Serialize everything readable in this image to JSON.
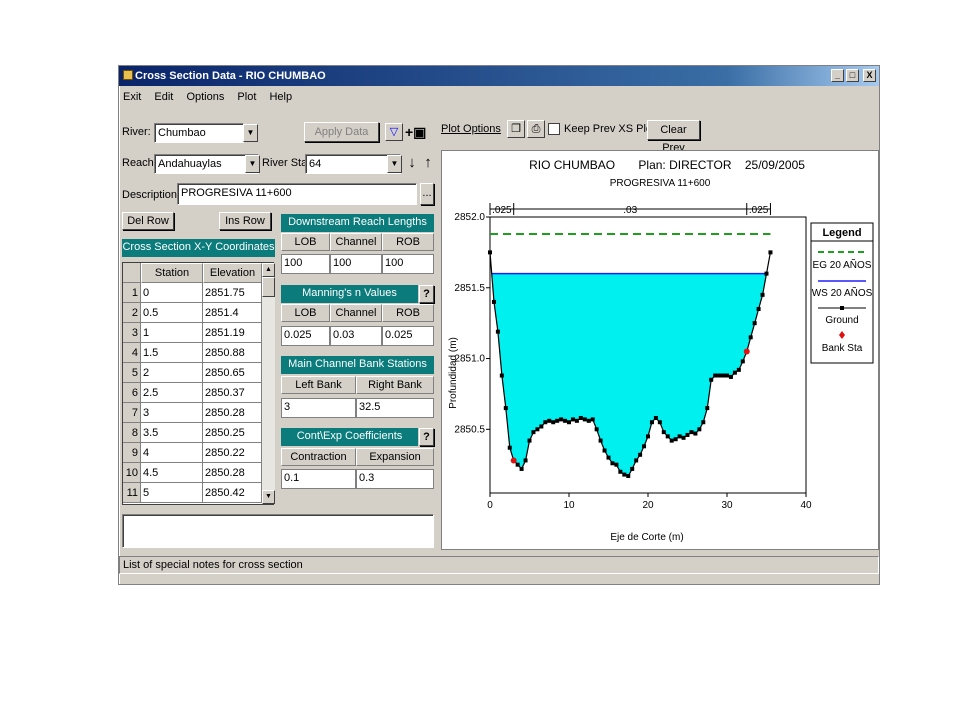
{
  "window": {
    "title": "Cross Section Data - RIO CHUMBAO",
    "min_label": "_",
    "max_label": "□",
    "close_label": "X"
  },
  "menu": [
    "Exit",
    "Edit",
    "Options",
    "Plot",
    "Help"
  ],
  "form": {
    "river_label": "River:",
    "river_value": "Chumbao",
    "reach_label": "Reach:",
    "reach_value": "Andahuaylas",
    "river_sta_label": "River Sta.:",
    "river_sta_value": "64",
    "description_label": "Description",
    "description_value": "PROGRESIVA 11+600",
    "apply_data": "Apply Data",
    "plot_options": "Plot Options",
    "keep_prev": "Keep Prev XS Plots",
    "clear_prev": "Clear Prev",
    "del_row": "Del Row",
    "ins_row": "Ins Row"
  },
  "xy_table": {
    "title": "Cross Section X-Y Coordinates",
    "col_station": "Station",
    "col_elevation": "Elevation",
    "rows": [
      {
        "n": "1",
        "station": "0",
        "elevation": "2851.75"
      },
      {
        "n": "2",
        "station": "0.5",
        "elevation": "2851.4"
      },
      {
        "n": "3",
        "station": "1",
        "elevation": "2851.19"
      },
      {
        "n": "4",
        "station": "1.5",
        "elevation": "2850.88"
      },
      {
        "n": "5",
        "station": "2",
        "elevation": "2850.65"
      },
      {
        "n": "6",
        "station": "2.5",
        "elevation": "2850.37"
      },
      {
        "n": "7",
        "station": "3",
        "elevation": "2850.28"
      },
      {
        "n": "8",
        "station": "3.5",
        "elevation": "2850.25"
      },
      {
        "n": "9",
        "station": "4",
        "elevation": "2850.22"
      },
      {
        "n": "10",
        "station": "4.5",
        "elevation": "2850.28"
      },
      {
        "n": "11",
        "station": "5",
        "elevation": "2850.42"
      }
    ]
  },
  "downstream": {
    "title": "Downstream Reach Lengths",
    "lob_label": "LOB",
    "channel_label": "Channel",
    "rob_label": "ROB",
    "lob": "100",
    "channel": "100",
    "rob": "100"
  },
  "manning": {
    "title": "Manning's n Values",
    "lob_label": "LOB",
    "channel_label": "Channel",
    "rob_label": "ROB",
    "lob": "0.025",
    "channel": "0.03",
    "rob": "0.025"
  },
  "bank": {
    "title": "Main Channel Bank Stations",
    "left_label": "Left Bank",
    "right_label": "Right Bank",
    "left": "3",
    "right": "32.5"
  },
  "coef": {
    "title": "Cont\\Exp Coefficients",
    "contraction_label": "Contraction",
    "expansion_label": "Expansion",
    "contraction": "0.1",
    "expansion": "0.3"
  },
  "status": "List of special notes for cross section",
  "chart_data": {
    "type": "area",
    "title": "RIO CHUMBAO       Plan: DIRECTOR    25/09/2005",
    "subtitle": "PROGRESIVA 11+600",
    "xlabel": "Eje de Corte (m)",
    "ylabel": "Profundidad (m)",
    "xlim": [
      0,
      40
    ],
    "ylim": [
      2850.05,
      2852.0
    ],
    "x_ticks": [
      0,
      10,
      20,
      30,
      40
    ],
    "y_ticks": [
      2850.5,
      2851.0,
      2851.5,
      2852.0
    ],
    "y_tick_labels": [
      "2850.5",
      "2851.0",
      "2851.5",
      "2852.0"
    ],
    "n_labels": [
      ".025",
      ".03",
      ".025"
    ],
    "eg_elevation": 2851.88,
    "ws_elevation": 2851.6,
    "bank_stations": [
      3,
      32.5
    ],
    "ground": {
      "x": [
        0,
        0.5,
        1,
        1.5,
        2,
        2.5,
        3,
        3.5,
        4,
        4.5,
        5,
        5.5,
        6,
        6.5,
        7,
        7.5,
        8,
        8.5,
        9,
        9.5,
        10,
        10.5,
        11,
        11.5,
        12,
        12.5,
        13,
        13.5,
        14,
        14.5,
        15,
        15.5,
        16,
        16.5,
        17,
        17.5,
        18,
        18.5,
        19,
        19.5,
        20,
        20.5,
        21,
        21.5,
        22,
        22.5,
        23,
        23.5,
        24,
        24.5,
        25,
        25.5,
        26,
        26.5,
        27,
        27.5,
        28,
        28.5,
        29,
        29.5,
        30,
        30.5,
        31,
        31.5,
        32,
        32.5,
        33,
        33.5,
        34,
        34.5,
        35,
        35.5
      ],
      "y": [
        2851.75,
        2851.4,
        2851.19,
        2850.88,
        2850.65,
        2850.37,
        2850.28,
        2850.25,
        2850.22,
        2850.28,
        2850.42,
        2850.48,
        2850.5,
        2850.52,
        2850.55,
        2850.56,
        2850.55,
        2850.56,
        2850.57,
        2850.56,
        2850.55,
        2850.57,
        2850.56,
        2850.58,
        2850.57,
        2850.56,
        2850.57,
        2850.5,
        2850.42,
        2850.35,
        2850.3,
        2850.26,
        2850.25,
        2850.2,
        2850.18,
        2850.17,
        2850.22,
        2850.28,
        2850.32,
        2850.38,
        2850.45,
        2850.55,
        2850.58,
        2850.55,
        2850.48,
        2850.45,
        2850.42,
        2850.43,
        2850.45,
        2850.44,
        2850.46,
        2850.48,
        2850.47,
        2850.5,
        2850.55,
        2850.65,
        2850.85,
        2850.88,
        2850.88,
        2850.88,
        2850.88,
        2850.87,
        2850.9,
        2850.92,
        2850.98,
        2851.05,
        2851.15,
        2851.25,
        2851.35,
        2851.45,
        2851.6,
        2851.75
      ]
    },
    "legend": {
      "title": "Legend",
      "entries": [
        "EG 20 AÑOS",
        "WS 20 AÑOS",
        "Ground",
        "Bank Sta"
      ]
    },
    "colors": {
      "water": "#00f0f0",
      "eg": "#1f9e1f",
      "ws": "#2020ff",
      "ground": "#000000",
      "bank": "#e01010"
    }
  }
}
